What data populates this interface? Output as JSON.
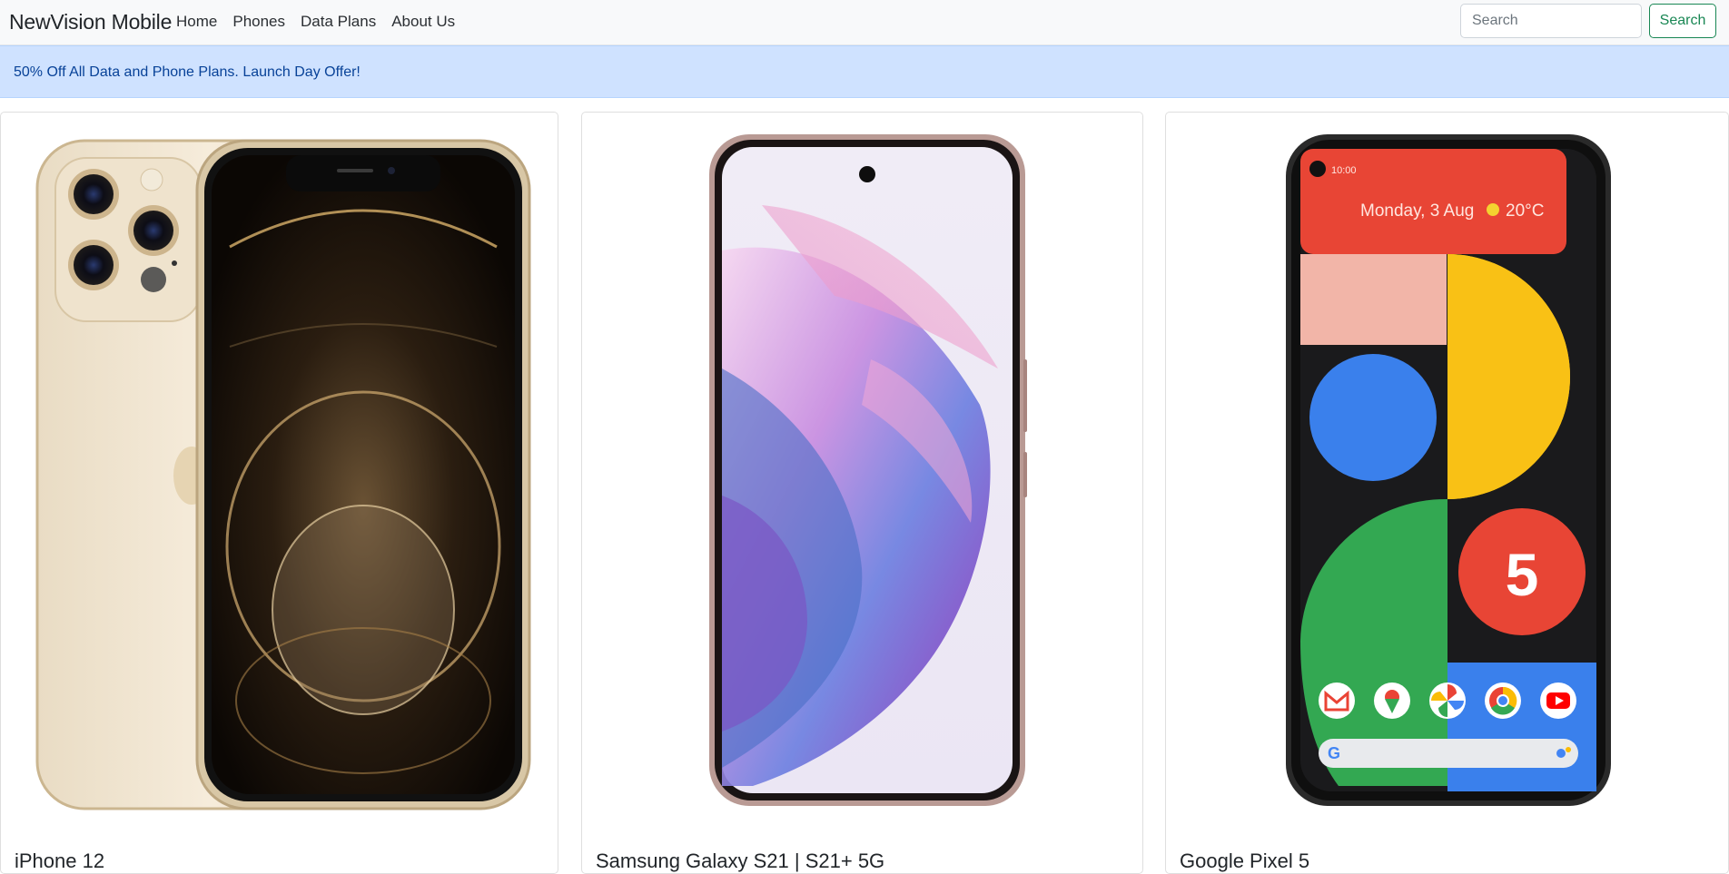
{
  "navbar": {
    "brand": "NewVision Mobile",
    "links": [
      "Home",
      "Phones",
      "Data Plans",
      "About Us"
    ],
    "search_placeholder": "Search",
    "search_button": "Search"
  },
  "alert": {
    "text": "50% Off All Data and Phone Plans. Launch Day Offer!"
  },
  "phones": [
    {
      "name": "iPhone 12",
      "image": "iphone-12-pro-gold-image"
    },
    {
      "name": "Samsung Galaxy S21 | S21+ 5G",
      "image": "samsung-galaxy-s21-phantom-violet-image"
    },
    {
      "name": "Google Pixel 5",
      "image": "google-pixel-5-image",
      "screen_text": {
        "date": "Monday, 3 Aug",
        "temp": "20°C",
        "time": "10:00",
        "badge": "5"
      }
    }
  ],
  "colors": {
    "navbar_bg": "#f8f9fa",
    "alert_bg": "#cfe2ff",
    "alert_text": "#084298",
    "success": "#198754"
  }
}
